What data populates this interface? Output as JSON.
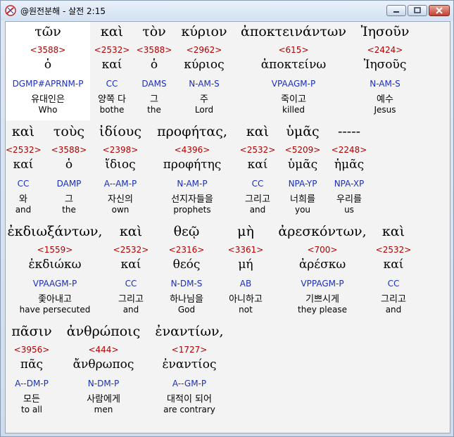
{
  "window": {
    "title": "@원전분해 - 살전 2:15"
  },
  "rows": [
    {
      "words": [
        {
          "greek": "τῶν",
          "strong": "<3588>",
          "lemma": "ὁ",
          "parse": "DGMP#APRNM-P",
          "korean": "유대인은",
          "english": "Who",
          "selected": true
        },
        {
          "greek": "καὶ",
          "strong": "<2532>",
          "lemma": "καί",
          "parse": "CC",
          "korean": "양쪽 다",
          "english": "bothe"
        },
        {
          "greek": "τὸν",
          "strong": "<3588>",
          "lemma": "ὁ",
          "parse": "DAMS",
          "korean": "그",
          "english": "the"
        },
        {
          "greek": "κύριον",
          "strong": "<2962>",
          "lemma": "κύριος",
          "parse": "N-AM-S",
          "korean": "주",
          "english": "Lord"
        },
        {
          "greek": "ἀποκτεινάντων",
          "strong": "<615>",
          "lemma": "ἀποκτείνω",
          "parse": "VPAAGM-P",
          "korean": "죽이고",
          "english": "killed"
        },
        {
          "greek": "Ἰησοῦν",
          "strong": "<2424>",
          "lemma": "Ἰησοῦς",
          "parse": "N-AM-S",
          "korean": "예수",
          "english": "Jesus"
        }
      ]
    },
    {
      "words": [
        {
          "greek": "καὶ",
          "strong": "<2532>",
          "lemma": "καί",
          "parse": "CC",
          "korean": "와",
          "english": "and"
        },
        {
          "greek": "τοὺς",
          "strong": "<3588>",
          "lemma": "ὁ",
          "parse": "DAMP",
          "korean": "그",
          "english": "the"
        },
        {
          "greek": "ἰδίους",
          "strong": "<2398>",
          "lemma": "ἴδιος",
          "parse": "A--AM-P",
          "korean": "자신의",
          "english": "own"
        },
        {
          "greek": "προφήτας,",
          "strong": "<4396>",
          "lemma": "προφήτης",
          "parse": "N-AM-P",
          "korean": "선지자들을",
          "english": "prophets"
        },
        {
          "greek": "καὶ",
          "strong": "<2532>",
          "lemma": "καί",
          "parse": "CC",
          "korean": "그리고",
          "english": "and"
        },
        {
          "greek": "ὑμᾶς",
          "strong": "<5209>",
          "lemma": "ὑμᾶς",
          "parse": "NPA-YP",
          "korean": "너희를",
          "english": "you"
        },
        {
          "greek": "-----",
          "strong": "<2248>",
          "lemma": "ἡμᾶς",
          "parse": "NPA-XP",
          "korean": "우리를",
          "english": "us"
        }
      ]
    },
    {
      "words": [
        {
          "greek": "ἐκδιωξάντων,",
          "strong": "<1559>",
          "lemma": "ἐκδιώκω",
          "parse": "VPAAGM-P",
          "korean": "좇아내고",
          "english": "have persecuted"
        },
        {
          "greek": "καὶ",
          "strong": "<2532>",
          "lemma": "καί",
          "parse": "CC",
          "korean": "그리고",
          "english": "and"
        },
        {
          "greek": "θεῷ",
          "strong": "<2316>",
          "lemma": "θεός",
          "parse": "N-DM-S",
          "korean": "하나님을",
          "english": "God"
        },
        {
          "greek": "μὴ",
          "strong": "<3361>",
          "lemma": "μή",
          "parse": "AB",
          "korean": "아니하고",
          "english": "not"
        },
        {
          "greek": "ἀρεσκόντων,",
          "strong": "<700>",
          "lemma": "ἀρέσκω",
          "parse": "VPPAGM-P",
          "korean": "기쁘시게",
          "english": "they please"
        },
        {
          "greek": "καὶ",
          "strong": "<2532>",
          "lemma": "καί",
          "parse": "CC",
          "korean": "그리고",
          "english": "and"
        }
      ]
    },
    {
      "words": [
        {
          "greek": "πᾶσιν",
          "strong": "<3956>",
          "lemma": "πᾶς",
          "parse": "A--DM-P",
          "korean": "모든",
          "english": "to all"
        },
        {
          "greek": "ἀνθρώποις",
          "strong": "<444>",
          "lemma": "ἄνθρωπος",
          "parse": "N-DM-P",
          "korean": "사람에게",
          "english": "men"
        },
        {
          "greek": "ἐναντίων,",
          "strong": "<1727>",
          "lemma": "ἐναντίος",
          "parse": "A--GM-P",
          "korean": "대적이 되어",
          "english": "are contrary"
        }
      ]
    }
  ]
}
